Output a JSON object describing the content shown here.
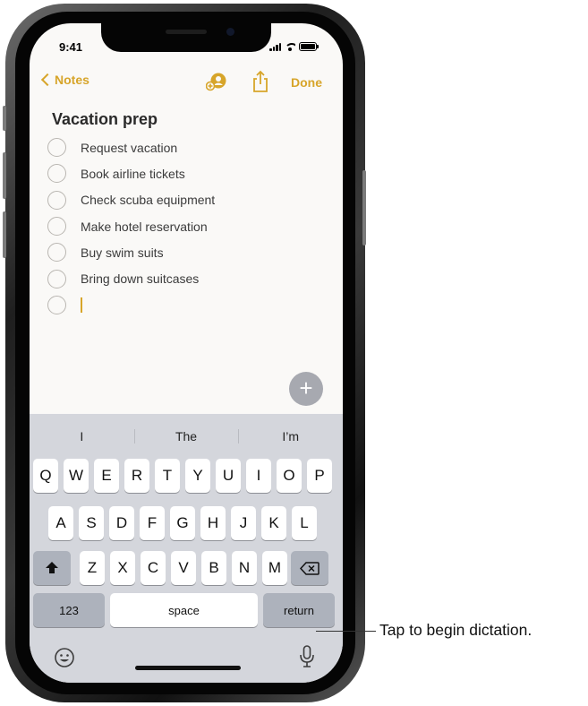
{
  "status_bar": {
    "time": "9:41"
  },
  "nav": {
    "back_label": "Notes",
    "done_label": "Done"
  },
  "note": {
    "title": "Vacation prep",
    "items": [
      "Request vacation",
      "Book airline tickets",
      "Check scuba equipment",
      "Make hotel reservation",
      "Buy swim suits",
      "Bring down suitcases"
    ]
  },
  "add_button": {
    "label": "+"
  },
  "keyboard": {
    "predictions": [
      "I",
      "The",
      "I’m"
    ],
    "row1": [
      "Q",
      "W",
      "E",
      "R",
      "T",
      "Y",
      "U",
      "I",
      "O",
      "P"
    ],
    "row2": [
      "A",
      "S",
      "D",
      "F",
      "G",
      "H",
      "J",
      "K",
      "L"
    ],
    "row3": [
      "Z",
      "X",
      "C",
      "V",
      "B",
      "N",
      "M"
    ],
    "numbers_label": "123",
    "space_label": "space",
    "return_label": "return"
  },
  "callout": {
    "text": "Tap to begin dictation."
  },
  "colors": {
    "accent": "#d7a52a",
    "keyboard_bg": "#d4d6dc",
    "key_dark": "#adb2bc"
  },
  "icons": [
    "chevron-left-icon",
    "collaborate-icon",
    "share-icon",
    "shift-icon",
    "backspace-icon",
    "emoji-icon",
    "microphone-icon",
    "plus-icon"
  ]
}
